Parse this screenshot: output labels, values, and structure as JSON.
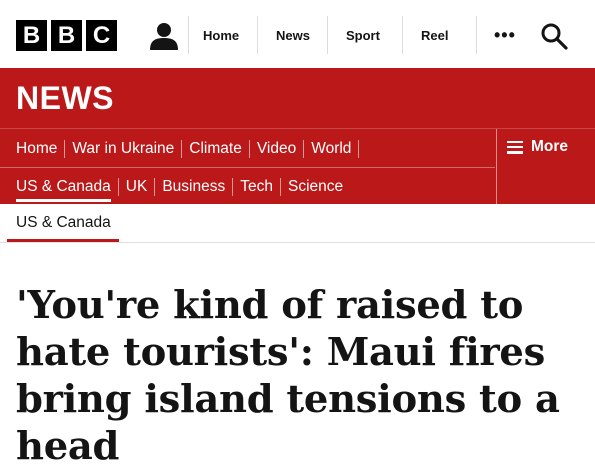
{
  "logo": {
    "letters": [
      "B",
      "B",
      "C"
    ]
  },
  "top_nav": {
    "items": [
      "Home",
      "News",
      "Sport",
      "Reel"
    ],
    "more_icon": "ellipsis-icon",
    "search_icon": "search-icon",
    "account_icon": "person-icon"
  },
  "banner": {
    "title": "NEWS"
  },
  "subnav": {
    "row1": [
      "Home",
      "War in Ukraine",
      "Climate",
      "Video",
      "World"
    ],
    "row2": [
      "US & Canada",
      "UK",
      "Business",
      "Tech",
      "Science"
    ],
    "active": "US & Canada",
    "more_label": "More"
  },
  "section": {
    "label": "US & Canada"
  },
  "article": {
    "headline": "'You're kind of raised to hate tourists': Maui fires bring island tensions to a head"
  },
  "colors": {
    "brand_red": "#bb1919",
    "text": "#141414"
  }
}
